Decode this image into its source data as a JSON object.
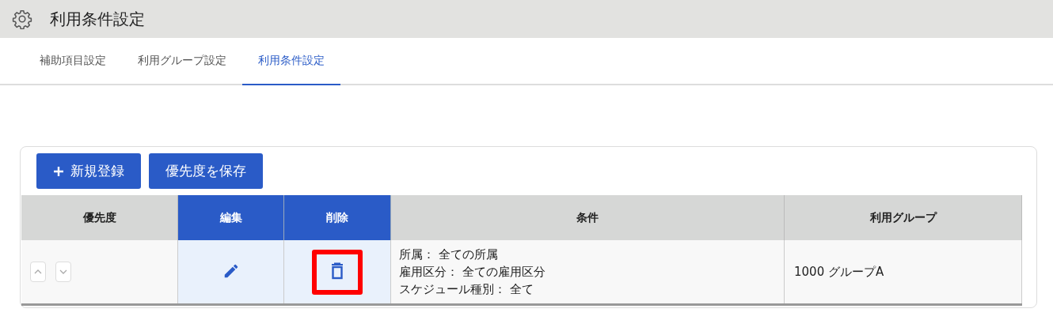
{
  "header": {
    "title": "利用条件設定"
  },
  "tabs": [
    {
      "label": "補助項目設定",
      "selected": false
    },
    {
      "label": "利用グループ設定",
      "selected": false
    },
    {
      "label": "利用条件設定",
      "selected": true
    }
  ],
  "buttons": [
    {
      "label": "新規登録",
      "kind": "add"
    },
    {
      "label": "優先度を保存",
      "kind": "plain"
    }
  ],
  "table": {
    "columns": [
      {
        "label": "優先度",
        "kind": "data"
      },
      {
        "label": "編集",
        "kind": "action"
      },
      {
        "label": "削除",
        "kind": "action"
      },
      {
        "label": "条件",
        "kind": "data"
      },
      {
        "label": "利用グループ",
        "kind": "data"
      }
    ],
    "rows": [
      {
        "conditions": [
          "所属： 全ての所属",
          "雇用区分： 全ての雇用区分",
          "スケジュール種別： 全て"
        ],
        "group": "1000 グループA",
        "delete_highlighted": true
      }
    ]
  }
}
